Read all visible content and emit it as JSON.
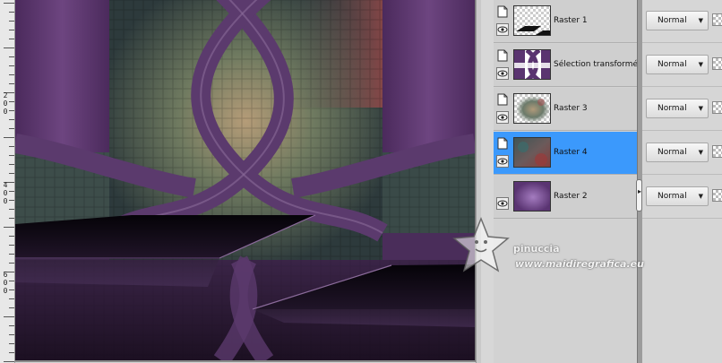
{
  "ruler": {
    "labels": [
      {
        "digits": [
          "2",
          "0",
          "0"
        ],
        "pos": "upper"
      },
      {
        "digits": [
          "4",
          "0",
          "0"
        ],
        "pos": "middle"
      },
      {
        "digits": [
          "6",
          "0",
          "0"
        ],
        "pos": "lower"
      }
    ]
  },
  "layers": [
    {
      "name": "Raster 1",
      "selected": false,
      "blend": "Normal",
      "thumb": "raster1-thumb"
    },
    {
      "name": "Sélection transformée",
      "selected": false,
      "blend": "Normal",
      "thumb": "selection-thumb"
    },
    {
      "name": "Raster 3",
      "selected": false,
      "blend": "Normal",
      "thumb": "raster3-thumb"
    },
    {
      "name": "Raster 4",
      "selected": true,
      "blend": "Normal",
      "thumb": "raster4-thumb"
    },
    {
      "name": "Raster 2",
      "selected": false,
      "blend": "Normal",
      "thumb": "raster2-thumb"
    }
  ],
  "watermark": {
    "name": "pinuccia",
    "url": "www.maidiregrafica.eu"
  },
  "colors": {
    "selection": "#3b99fc",
    "purple": "#5e3a70",
    "dark_purple": "#2f1c3a"
  }
}
